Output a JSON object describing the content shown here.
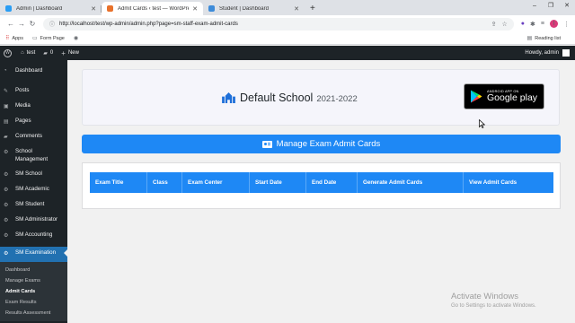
{
  "browser": {
    "tabs": [
      {
        "title": "Admin | Dashboard",
        "favicon_color": "#2a9df4",
        "active": false
      },
      {
        "title": "Admit Cards ‹ test — WordPress",
        "favicon_color": "#e8712b",
        "active": true
      },
      {
        "title": "Student | Dashboard",
        "favicon_color": "#3d8bd9",
        "active": false
      }
    ],
    "url": "http://localhost/test/wp-admin/admin.php?page=sm-staff-exam-admit-cards",
    "bookmarks": [
      "Apps",
      "Form Page"
    ],
    "reading_list": "Reading list"
  },
  "adminbar": {
    "site_name": "test",
    "comments_count": "0",
    "new_label": "New",
    "howdy": "Howdy, admin"
  },
  "sidebar": {
    "items": [
      {
        "label": "Dashboard",
        "icon": "dashboard-icon"
      },
      {
        "label": "Posts",
        "icon": "pin-icon"
      },
      {
        "label": "Media",
        "icon": "media-icon"
      },
      {
        "label": "Pages",
        "icon": "pages-icon"
      },
      {
        "label": "Comments",
        "icon": "comments-icon"
      },
      {
        "label": "School Management",
        "icon": "school-icon"
      },
      {
        "label": "SM School",
        "icon": "gear-icon"
      },
      {
        "label": "SM Academic",
        "icon": "gear-icon"
      },
      {
        "label": "SM Student",
        "icon": "gear-icon"
      },
      {
        "label": "SM Administrator",
        "icon": "gear-icon"
      },
      {
        "label": "SM Accounting",
        "icon": "gear-icon"
      },
      {
        "label": "SM Examination",
        "icon": "gear-icon",
        "active": true
      }
    ],
    "submenu": [
      "Dashboard",
      "Manage Exams",
      "Admit Cards",
      "Exam Results",
      "Results Assessment"
    ],
    "current_submenu": "Admit Cards"
  },
  "header": {
    "school_name": "Default School",
    "session": "2021-2022",
    "store_badge_small": "ANDROID APP ON",
    "store_badge_big": "Google play"
  },
  "page_title": "Manage Exam Admit Cards",
  "table": {
    "columns": [
      "Exam Title",
      "Class",
      "Exam Center",
      "Start Date",
      "End Date",
      "Generate Admit Cards",
      "View Admit Cards"
    ],
    "rows": []
  },
  "watermark": {
    "title": "Activate Windows",
    "subtitle": "Go to Settings to activate Windows."
  },
  "colors": {
    "accent": "#1e88f5",
    "wp_dark": "#1d2327",
    "wp_active": "#2271b1"
  }
}
